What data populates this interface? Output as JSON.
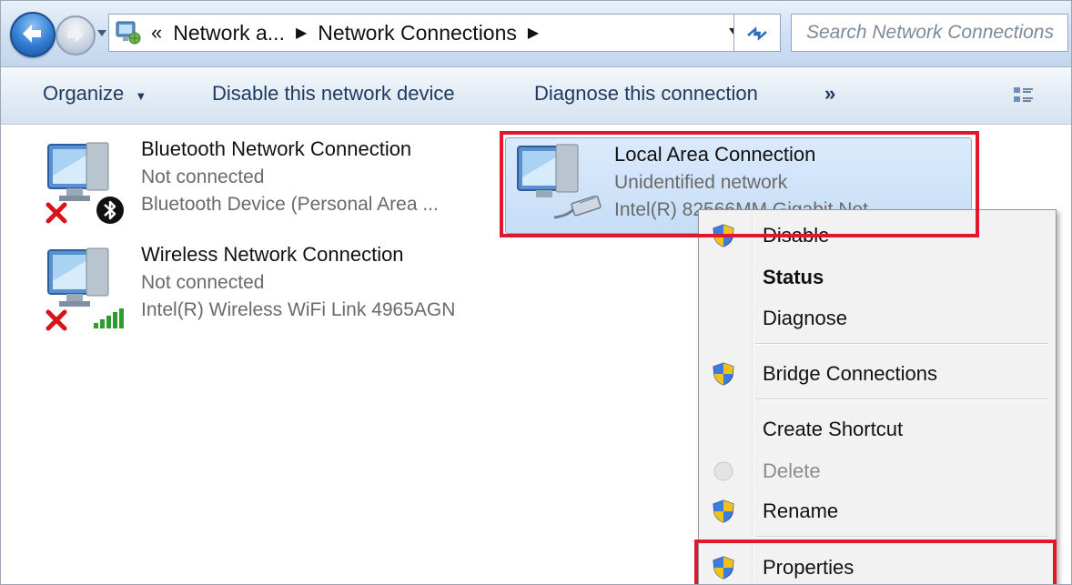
{
  "address_bar": {
    "breadcrumb": [
      "Network a...",
      "Network Connections"
    ],
    "overflow_marker": "«",
    "search_placeholder": "Search Network Connections"
  },
  "toolbar": {
    "organize": "Organize",
    "disable": "Disable this network device",
    "diagnose": "Diagnose this connection",
    "more": "»"
  },
  "connections": [
    {
      "name": "Bluetooth Network Connection",
      "status": "Not connected",
      "device": "Bluetooth Device (Personal Area ...",
      "overlay": "bluetooth-icon",
      "error": true
    },
    {
      "name": "Wireless Network Connection",
      "status": "Not connected",
      "device": "Intel(R) Wireless WiFi Link 4965AGN",
      "overlay": "signal-bars-icon",
      "error": true
    },
    {
      "name": "Local Area Connection",
      "status": "Unidentified network",
      "device": "Intel(R) 82566MM Gigabit Net...",
      "overlay": "ethernet-cable-icon",
      "error": false,
      "selected": true
    }
  ],
  "context_menu": {
    "items": [
      {
        "label": "Disable",
        "shield": true
      },
      {
        "label": "Status",
        "bold": true
      },
      {
        "label": "Diagnose"
      },
      {
        "label": "Bridge Connections",
        "shield": true
      },
      {
        "label": "Create Shortcut"
      },
      {
        "label": "Delete",
        "disabled": true
      },
      {
        "label": "Rename",
        "shield": true
      },
      {
        "label": "Properties",
        "shield": true,
        "highlighted": true
      }
    ]
  },
  "colors": {
    "highlight_red": "#e2172b",
    "selection_blue": "#c6ddf7",
    "toolbar_text": "#1e3a5f"
  }
}
